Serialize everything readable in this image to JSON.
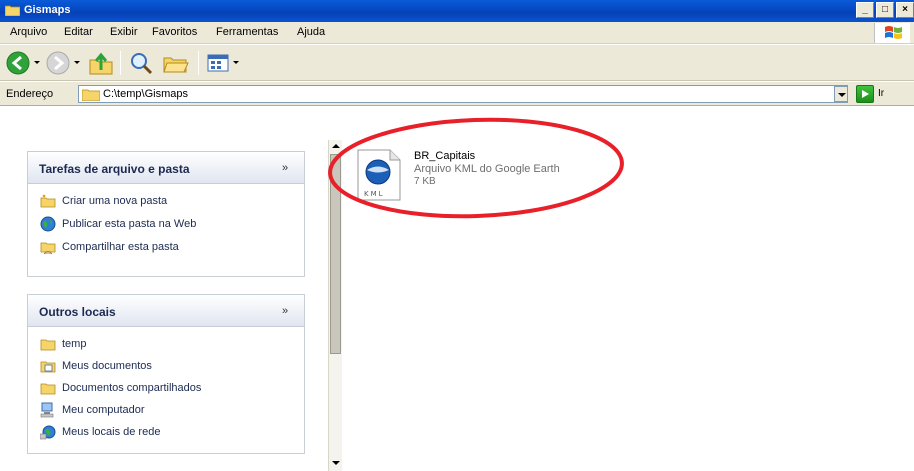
{
  "window": {
    "title": "Gismaps",
    "icon": "folder-icon",
    "controls": [
      "minimize",
      "maximize",
      "close"
    ]
  },
  "menu": {
    "items": [
      "Arquivo",
      "Editar",
      "Exibir",
      "Favoritos",
      "Ferramentas",
      "Ajuda"
    ]
  },
  "toolbar": {
    "buttons": [
      "back-icon",
      "forward-icon",
      "up-folder-icon",
      "search-icon",
      "folders-icon",
      "views-icon"
    ]
  },
  "address": {
    "label": "Endereço",
    "value": "C:\\temp\\Gismaps",
    "go_label": "Ir"
  },
  "tasks": {
    "title": "Tarefas de arquivo e pasta",
    "items": [
      {
        "label": "Criar uma nova pasta",
        "icon": "new-folder-icon"
      },
      {
        "label": "Publicar esta pasta na Web",
        "icon": "globe-icon"
      },
      {
        "label": "Compartilhar esta pasta",
        "icon": "share-folder-icon"
      }
    ]
  },
  "other_places": {
    "title": "Outros locais",
    "items": [
      {
        "label": "temp",
        "icon": "folder-icon"
      },
      {
        "label": "Meus documentos",
        "icon": "my-documents-icon"
      },
      {
        "label": "Documentos compartilhados",
        "icon": "folder-icon"
      },
      {
        "label": "Meu computador",
        "icon": "computer-icon"
      },
      {
        "label": "Meus locais de rede",
        "icon": "network-icon"
      }
    ]
  },
  "file": {
    "name": "BR_Capitais",
    "type": "Arquivo KML do Google Earth",
    "size": "7 KB",
    "icon_text": "KML",
    "icon": "kml-file-icon"
  },
  "colors": {
    "titlebar": "#0548c3",
    "panel_title": "#1c2a52",
    "highlight_circle": "#e8202a"
  }
}
